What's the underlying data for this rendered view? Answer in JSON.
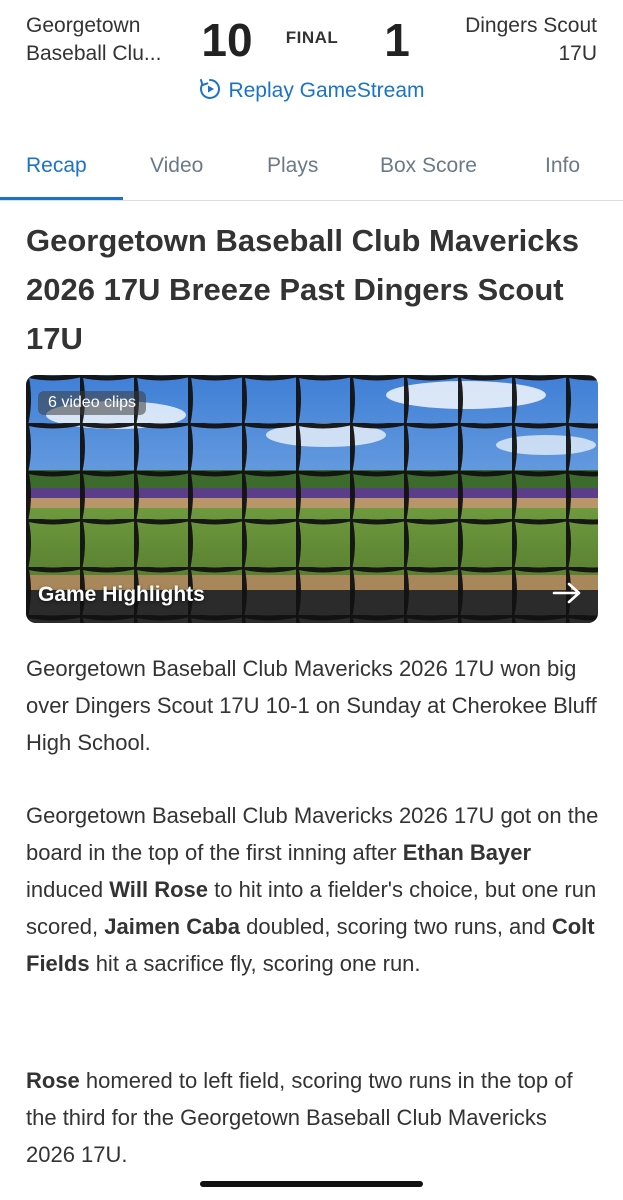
{
  "scoreboard": {
    "home_team_line1": "Georgetown",
    "home_team_line2": "Baseball Clu...",
    "home_score": "10",
    "status": "FINAL",
    "away_score": "1",
    "away_team_line1": "Dingers Scout",
    "away_team_line2": "17U",
    "replay_label": "Replay GameStream",
    "replay_icon": "replay-icon"
  },
  "tabs": [
    {
      "label": "Recap",
      "active": true
    },
    {
      "label": "Video",
      "active": false
    },
    {
      "label": "Plays",
      "active": false
    },
    {
      "label": "Box Score",
      "active": false
    },
    {
      "label": "Info",
      "active": false
    }
  ],
  "article": {
    "headline": "Georgetown Baseball Club Mavericks 2026 17U Breeze Past Dingers Scout 17U",
    "media": {
      "clips_badge": "6 video clips",
      "title": "Game Highlights",
      "arrow_icon": "arrow-right-icon"
    },
    "para1": "Georgetown Baseball Club Mavericks 2026 17U won big over Dingers Scout 17U 10-1 on Sunday at Cherokee Bluff High School.",
    "para2": {
      "t1": "Georgetown Baseball Club Mavericks 2026 17U got on the board in the top of the first inning after ",
      "b1": "Ethan Bayer",
      "t2": " induced ",
      "b2": "Will Rose",
      "t3": " to hit into a fielder's choice, but one run scored, ",
      "b3": "Jaimen Caba",
      "t4": " doubled, scoring two runs, and ",
      "b4": "Colt Fields",
      "t5": " hit a sacrifice fly, scoring one run."
    },
    "para3": {
      "b1": "Rose",
      "t1": " homered to left field, scoring two runs in the top of the third for the Georgetown Baseball Club Mavericks 2026 17U."
    }
  },
  "colors": {
    "accent": "#1a73c9",
    "tab_inactive": "#6b7a86",
    "text": "#333333"
  }
}
